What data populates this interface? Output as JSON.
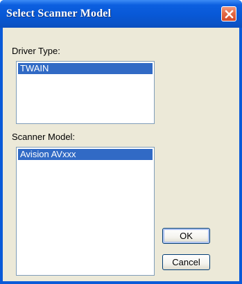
{
  "window": {
    "title": "Select Scanner Model"
  },
  "driver_type": {
    "label": "Driver Type:",
    "items": [
      "TWAIN"
    ],
    "selected": "TWAIN"
  },
  "scanner_model": {
    "label": "Scanner Model:",
    "items": [
      "Avision AVxxx"
    ],
    "selected": "Avision AVxxx"
  },
  "buttons": {
    "ok_label": "OK",
    "cancel_label": "Cancel"
  },
  "colors": {
    "title_bar": "#0858d6",
    "selection": "#316ac5",
    "dialog_face": "#ece9d8",
    "close_button": "#e36a45"
  },
  "icons": {
    "close": "close-icon"
  }
}
